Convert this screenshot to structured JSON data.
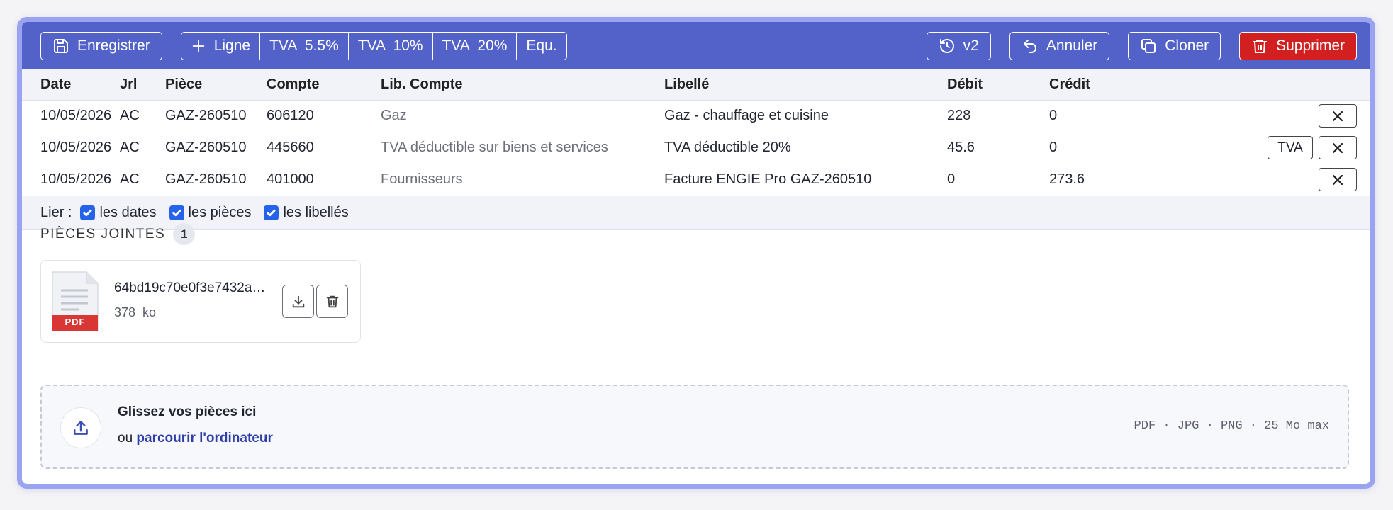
{
  "toolbar": {
    "save_label": "Enregistrer",
    "add_line_label": "Ligne",
    "vat_55_label": "TVA  5.5%",
    "vat_10_label": "TVA  10%",
    "vat_20_label": "TVA  20%",
    "balance_label": "Equ.",
    "version_label": "v2",
    "cancel_label": "Annuler",
    "clone_label": "Cloner",
    "delete_label": "Supprimer"
  },
  "table": {
    "headers": {
      "date": "Date",
      "jrl": "Jrl",
      "piece": "Pièce",
      "compte": "Compte",
      "lib_compte": "Lib. Compte",
      "libelle": "Libellé",
      "debit": "Débit",
      "credit": "Crédit"
    },
    "rows": [
      {
        "date": "10/05/2026",
        "jrl": "AC",
        "piece": "GAZ-260510",
        "compte": "606120",
        "lib_compte": "Gaz",
        "libelle": "Gaz - chauffage et cuisine",
        "debit": "228",
        "credit": "0"
      },
      {
        "date": "10/05/2026",
        "jrl": "AC",
        "piece": "GAZ-260510",
        "compte": "445660",
        "lib_compte": "TVA déductible sur biens et services",
        "libelle": "TVA déductible 20%",
        "debit": "45.6",
        "credit": "0",
        "tva_label": "TVA"
      },
      {
        "date": "10/05/2026",
        "jrl": "AC",
        "piece": "GAZ-260510",
        "compte": "401000",
        "lib_compte": "Fournisseurs",
        "libelle": "Facture ENGIE Pro GAZ-260510",
        "debit": "0",
        "credit": "273.6"
      }
    ]
  },
  "link_bar": {
    "label": "Lier :",
    "options": [
      {
        "label": "les dates",
        "checked": true
      },
      {
        "label": "les pièces",
        "checked": true
      },
      {
        "label": "les libellés",
        "checked": true
      }
    ]
  },
  "attachments": {
    "title": "PIÈCES JOINTES",
    "count": "1",
    "files": [
      {
        "name": "64bd19c70e0f3e7432a…",
        "size": "378  ko",
        "type_badge": "PDF"
      }
    ]
  },
  "dropzone": {
    "title": "Glissez vos pièces ici",
    "prefix": "ou",
    "browse_link": "parcourir l'ordinateur",
    "formats": "PDF · JPG · PNG · 25 Mo max"
  },
  "colors": {
    "toolbar_bg": "#5262c8",
    "danger": "#d21f1f",
    "checkbox": "#2563eb",
    "link": "#2f3ea8",
    "frame_border": "#9aa3f2"
  }
}
